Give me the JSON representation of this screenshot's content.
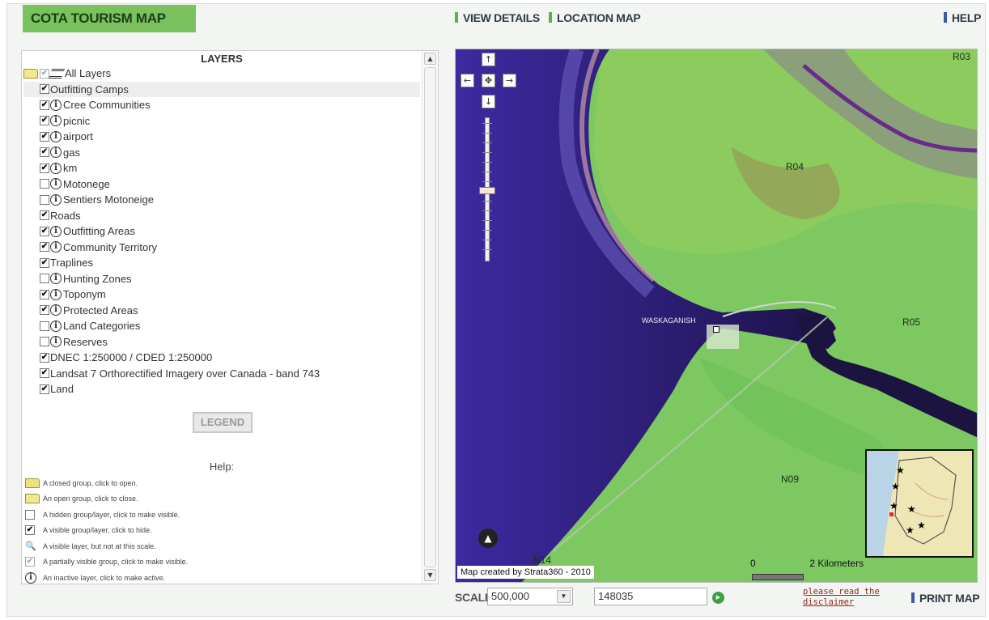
{
  "header": {
    "title": "COTA TOURISM MAP",
    "view_details": "VIEW DETAILS",
    "location_map": "LOCATION MAP",
    "help": "HELP"
  },
  "layers": {
    "title": "LAYERS",
    "items": [
      {
        "label": "All Layers",
        "checked": "partial",
        "info": false,
        "indent": 0
      },
      {
        "label": "Outfitting Camps",
        "checked": true,
        "info": false,
        "indent": 1
      },
      {
        "label": "Cree Communities",
        "checked": true,
        "info": true,
        "indent": 1
      },
      {
        "label": "picnic",
        "checked": true,
        "info": true,
        "indent": 1
      },
      {
        "label": "airport",
        "checked": true,
        "info": true,
        "indent": 1
      },
      {
        "label": "gas",
        "checked": true,
        "info": true,
        "indent": 1
      },
      {
        "label": "km",
        "checked": true,
        "info": true,
        "indent": 1
      },
      {
        "label": "Motonege",
        "checked": false,
        "info": true,
        "indent": 1
      },
      {
        "label": "Sentiers Motoneige",
        "checked": false,
        "info": true,
        "indent": 1
      },
      {
        "label": "Roads",
        "checked": true,
        "info": false,
        "indent": 1
      },
      {
        "label": "Outfitting Areas",
        "checked": true,
        "info": true,
        "indent": 1
      },
      {
        "label": "Community Territory",
        "checked": true,
        "info": true,
        "indent": 1
      },
      {
        "label": "Traplines",
        "checked": true,
        "info": false,
        "indent": 1
      },
      {
        "label": "Hunting Zones",
        "checked": false,
        "info": true,
        "indent": 1
      },
      {
        "label": "Toponym",
        "checked": true,
        "info": true,
        "indent": 1
      },
      {
        "label": "Protected Areas",
        "checked": true,
        "info": true,
        "indent": 1
      },
      {
        "label": "Land Categories",
        "checked": false,
        "info": true,
        "indent": 1
      },
      {
        "label": "Reserves",
        "checked": false,
        "info": true,
        "indent": 1
      },
      {
        "label": "DNEC 1:250000 / CDED 1:250000",
        "checked": true,
        "info": false,
        "indent": 1
      },
      {
        "label": "Landsat 7 Orthorectified Imagery over Canada - band 743",
        "checked": true,
        "info": false,
        "indent": 1
      },
      {
        "label": "Land",
        "checked": true,
        "info": false,
        "indent": 1
      }
    ],
    "legend_label": "LEGEND",
    "help_title": "Help:",
    "help_items": [
      {
        "icon": "closed-folder",
        "text": "A closed group, click to open."
      },
      {
        "icon": "open-folder",
        "text": "An open group, click to close."
      },
      {
        "icon": "hidden-checkbox",
        "text": "A hidden group/layer, click to make visible."
      },
      {
        "icon": "checked-checkbox",
        "text": "A visible group/layer, click to hide."
      },
      {
        "icon": "magnifier",
        "text": "A visible layer, but not at this scale."
      },
      {
        "icon": "partial-checkbox",
        "text": "A partially visible group, click to make visible."
      },
      {
        "icon": "info",
        "text": "An inactive layer, click to make active."
      }
    ]
  },
  "map": {
    "labels": {
      "r03": "R03",
      "r04": "R04",
      "r05": "R05",
      "n09": "N09",
      "n14": "N14",
      "town": "WASKAGANISH"
    },
    "credit": "Map created by Strata360 - 2010",
    "scalebar": {
      "zero": "0",
      "distance": "2 Kilometers"
    }
  },
  "footer": {
    "scale_label": "SCALE",
    "scale_value": "500,000",
    "scale_input": "148035",
    "disclaimer": "please read the disclaimer",
    "print_map": "PRINT MAP"
  },
  "colors": {
    "title_tab": "#79c25e",
    "water": "#2d1f75",
    "land": "#7ec862",
    "link_bar_green": "#5bb342",
    "link_bar_blue": "#3d57a8"
  }
}
